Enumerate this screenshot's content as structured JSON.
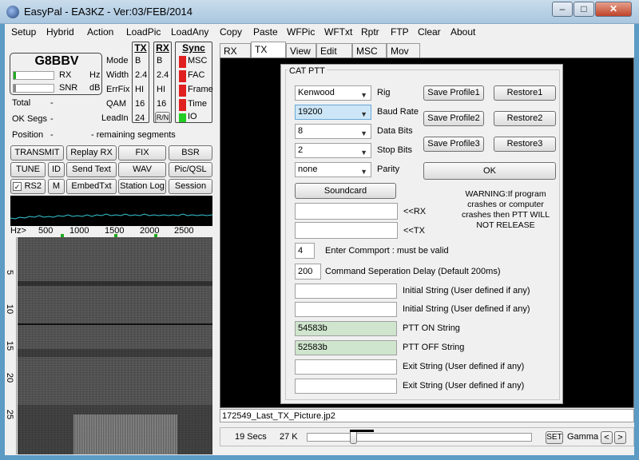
{
  "window": {
    "title": "EasyPal - EA3KZ - Ver:03/FEB/2014",
    "minimize": "–",
    "maximize": "□",
    "close": "✕"
  },
  "menu": [
    "Setup",
    "Hybrid",
    "Action",
    "LoadPic",
    "LoadAny",
    "Copy",
    "Paste",
    "WFPic",
    "WFTxt",
    "Rptr",
    "FTP",
    "Clear",
    "About"
  ],
  "station": {
    "callsign": "G8BBV",
    "rx_label": "RX",
    "rx_unit": "Hz",
    "snr_label": "SNR",
    "snr_unit": "dB"
  },
  "params": {
    "tx_header": "TX",
    "rx_header": "RX",
    "sync_header": "Sync",
    "rows": [
      {
        "label": "Mode",
        "tx": "B",
        "rx": "B"
      },
      {
        "label": "Width",
        "tx": "2.4",
        "rx": "2.4"
      },
      {
        "label": "ErrFix",
        "tx": "HI",
        "rx": "HI"
      },
      {
        "label": "QAM",
        "tx": "16",
        "rx": "16"
      },
      {
        "label": "LeadIn",
        "tx": "24",
        "rx": "R/N"
      }
    ],
    "sync": [
      {
        "label": "MSC",
        "color": "#e02020"
      },
      {
        "label": "FAC",
        "color": "#e02020"
      },
      {
        "label": "Frame",
        "color": "#e02020"
      },
      {
        "label": "Time",
        "color": "#e02020"
      },
      {
        "label": "IO",
        "color": "#22cc22"
      }
    ]
  },
  "status": {
    "total_label": "Total",
    "total_value": "-",
    "okseg_label": "OK Segs",
    "okseg_value": "-",
    "position_label": "Position",
    "position_value": "-",
    "remaining_label": "-  remaining segments"
  },
  "buttons": {
    "transmit": "TRANSMIT",
    "replay": "Replay RX",
    "fix": "FIX",
    "bsr": "BSR",
    "tune": "TUNE",
    "id": "ID",
    "send_text": "Send Text",
    "wav": "WAV",
    "picqsl": "Pic/QSL",
    "rs2": "RS2",
    "m": "M",
    "embed": "EmbedTxt",
    "station_log": "Station Log",
    "session": "Session"
  },
  "rs2_check": "✓",
  "freq_scale": {
    "hz": "Hz>",
    "ticks": [
      "500",
      "1000",
      "1500",
      "2000",
      "2500"
    ]
  },
  "time_ticks": [
    "5",
    "10",
    "15",
    "20",
    "25"
  ],
  "tabs": [
    "RX",
    "TX",
    "View",
    "Edit",
    "MSC",
    "Mov"
  ],
  "cat": {
    "title": "CAT PTT",
    "rig": {
      "value": "Kenwood",
      "label": "Rig"
    },
    "baud": {
      "value": "19200",
      "label": "Baud Rate"
    },
    "databits": {
      "value": "8",
      "label": "Data Bits"
    },
    "stopbits": {
      "value": "2",
      "label": "Stop Bits"
    },
    "parity": {
      "value": "none",
      "label": "Parity"
    },
    "save1": "Save Profile1",
    "restore1": "Restore1",
    "save2": "Save Profile2",
    "restore2": "Restore2",
    "save3": "Save Profile3",
    "restore3": "Restore3",
    "ok": "OK",
    "soundcard": "Soundcard",
    "warning": "WARNING:If program crashes or computer crashes then PTT WILL NOT RELEASE",
    "rx_label": "<<RX",
    "tx_label": "<<TX",
    "comport": {
      "value": "4",
      "label": "Enter Commport : must be valid"
    },
    "delay": {
      "value": "200",
      "label": "Command Seperation Delay (Default 200ms)"
    },
    "strings": [
      {
        "value": "",
        "label": "Initial String (User defined if any)",
        "green": false
      },
      {
        "value": "",
        "label": "Initial String (User defined if any)",
        "green": false
      },
      {
        "value": "54583b",
        "label": "PTT ON String",
        "green": true
      },
      {
        "value": "52583b",
        "label": "PTT OFF String",
        "green": true
      },
      {
        "value": "",
        "label": "Exit String (User defined if any)",
        "green": false
      },
      {
        "value": "",
        "label": "Exit String (User defined if any)",
        "green": false
      }
    ]
  },
  "file_name": "172549_Last_TX_Picture.jp2",
  "bottom": {
    "secs": "19 Secs",
    "size": "27 K",
    "set": "SET",
    "gamma": "Gamma",
    "prev": "<",
    "next": ">"
  }
}
